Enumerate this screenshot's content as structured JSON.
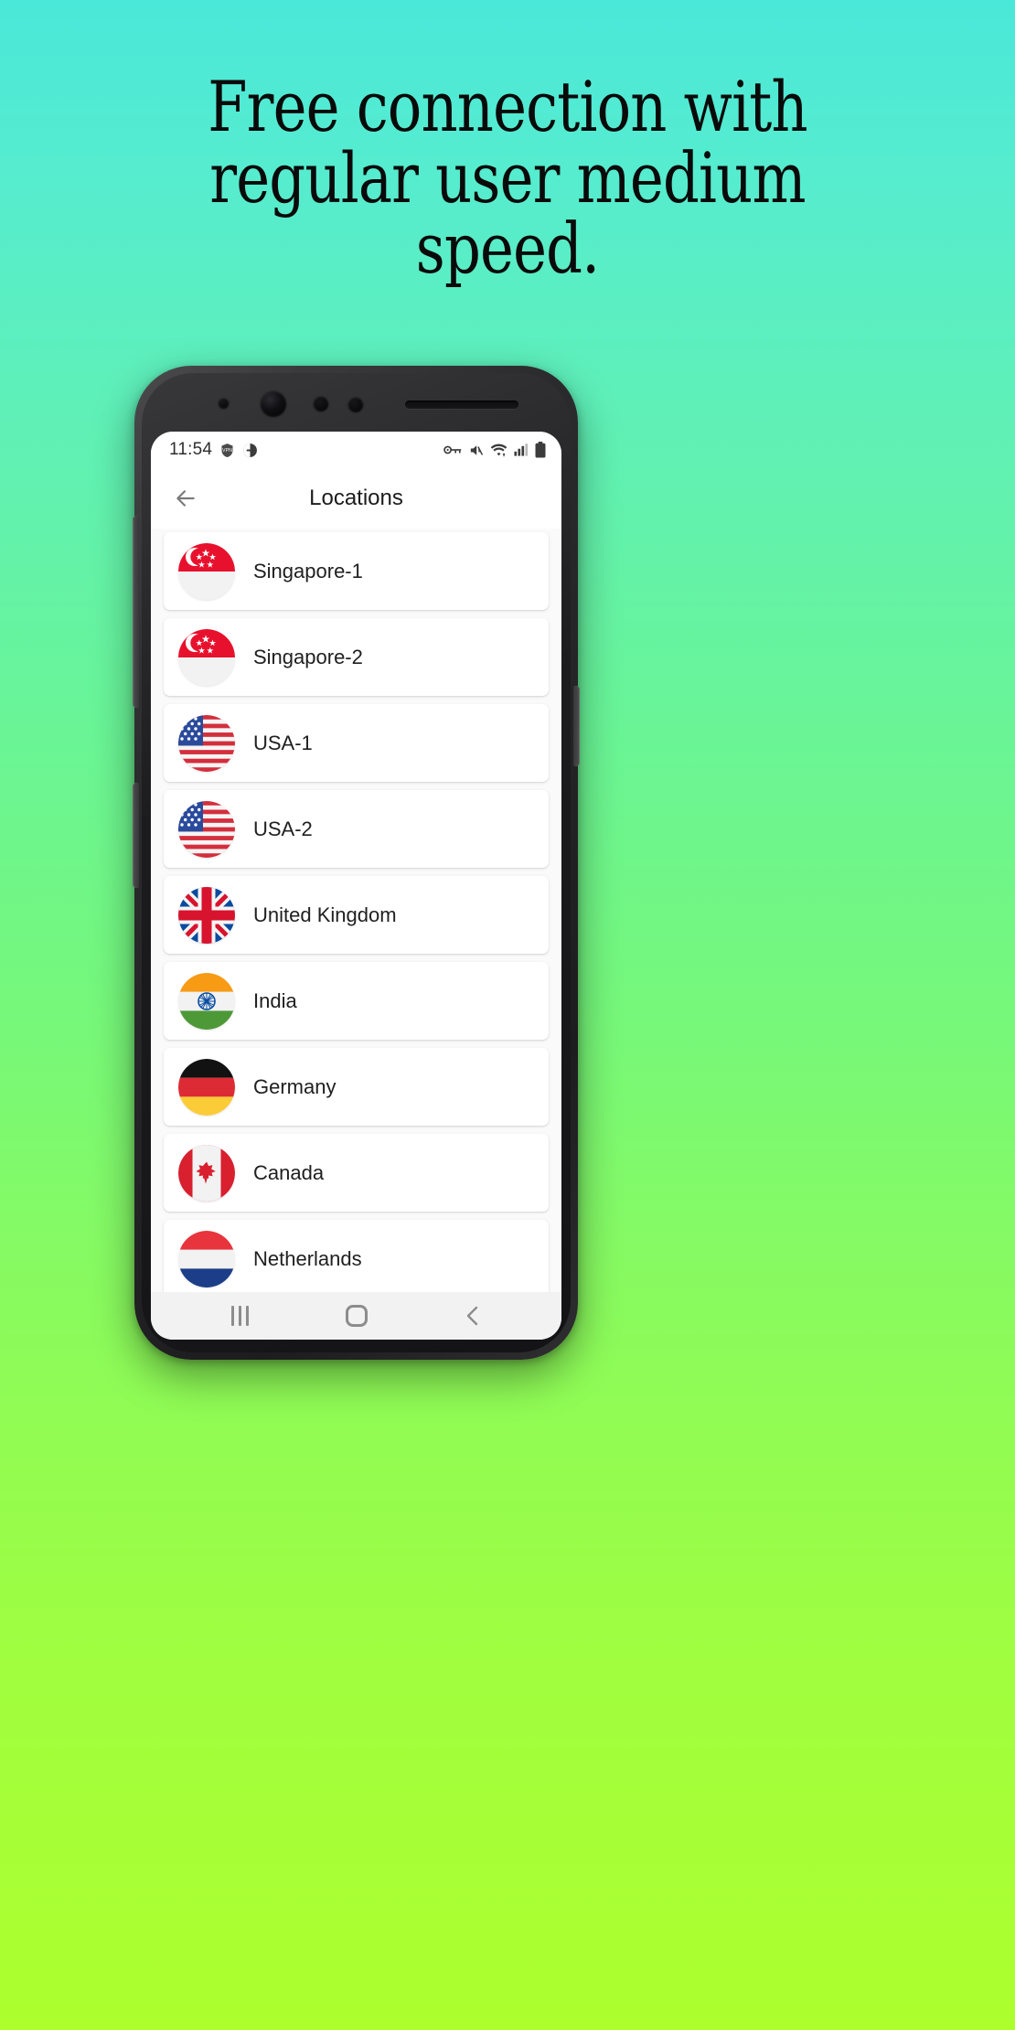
{
  "promo": {
    "headline_lines": [
      "Free connection with",
      "regular user medium",
      "speed."
    ]
  },
  "colors": {
    "gradient_top": "#4AE8D9",
    "gradient_bottom": "#ADFF2C",
    "headline_color": "#0A0A0A",
    "card_background": "#FFFFFF",
    "list_background": "#FAFAFA",
    "navbar_background": "#F2F2F2"
  },
  "phone": {
    "status_bar": {
      "time": "11:54",
      "left_icons": [
        "vpn-shield-icon",
        "do-not-disturb-icon"
      ],
      "right_icons": [
        "vpn-key-icon",
        "volume-muted-icon",
        "wifi-icon",
        "cellular-signal-icon",
        "battery-icon"
      ]
    },
    "app_bar": {
      "back_label": "back-arrow",
      "title": "Locations"
    },
    "locations": [
      {
        "name": "Singapore-1",
        "flag": "singapore-flag"
      },
      {
        "name": "Singapore-2",
        "flag": "singapore-flag"
      },
      {
        "name": "USA-1",
        "flag": "usa-flag"
      },
      {
        "name": "USA-2",
        "flag": "usa-flag"
      },
      {
        "name": "United Kingdom",
        "flag": "united-kingdom-flag"
      },
      {
        "name": "India",
        "flag": "india-flag"
      },
      {
        "name": "Germany",
        "flag": "germany-flag"
      },
      {
        "name": "Canada",
        "flag": "canada-flag"
      },
      {
        "name": "Netherlands",
        "flag": "netherlands-flag"
      }
    ],
    "nav_bar": {
      "recents_label": "recents",
      "home_label": "home",
      "back_label": "back"
    }
  }
}
